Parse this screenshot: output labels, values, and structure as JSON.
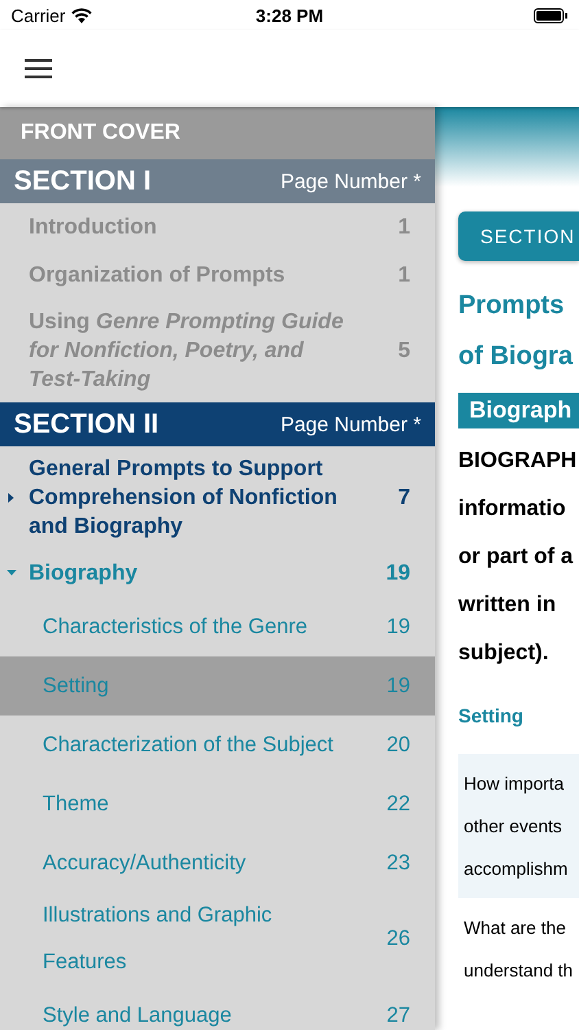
{
  "status_bar": {
    "carrier": "Carrier",
    "time": "3:28 PM"
  },
  "sidebar": {
    "front_cover": "FRONT COVER",
    "sections": [
      {
        "title": "SECTION I",
        "page_header": "Page Number *",
        "active": false,
        "items": [
          {
            "title": "Introduction",
            "page": "1"
          },
          {
            "title": "Organization of Prompts",
            "page": "1"
          },
          {
            "title": "Using *Genre Prompting Guide for Nonfiction, Poetry, and Test-Taking*",
            "page": "5"
          }
        ]
      },
      {
        "title": "SECTION II",
        "page_header": "Page Number *",
        "active": true,
        "items": [
          {
            "title": "General Prompts to Support Comprehension of Nonfiction and Biography",
            "page": "7",
            "expanded": false
          },
          {
            "title": "Biography",
            "page": "19",
            "expanded": true,
            "children": [
              {
                "title": "Characteristics of the Genre",
                "page": "19",
                "selected": false
              },
              {
                "title": "Setting",
                "page": "19",
                "selected": true
              },
              {
                "title": "Characterization of the Subject",
                "page": "20",
                "selected": false
              },
              {
                "title": "Theme",
                "page": "22",
                "selected": false
              },
              {
                "title": "Accuracy/Authenticity",
                "page": "23",
                "selected": false
              },
              {
                "title": "Illustrations and Graphic Features",
                "page": "26",
                "selected": false
              },
              {
                "title": "Style and Language",
                "page": "27",
                "selected": false
              }
            ]
          }
        ]
      }
    ]
  },
  "content": {
    "section_button": "SECTION",
    "heading_lines": [
      "Prompts",
      "of Biogra"
    ],
    "label": "Biograph",
    "definition_lines": [
      "BIOGRAPH",
      "informatio",
      "or part of a",
      "written in",
      "subject)."
    ],
    "subheading": "Setting",
    "rows": [
      {
        "shaded": true,
        "lines": [
          "How importa",
          "other events",
          "accomplishm"
        ]
      },
      {
        "shaded": false,
        "lines": [
          "What are the",
          "understand th"
        ]
      }
    ]
  }
}
